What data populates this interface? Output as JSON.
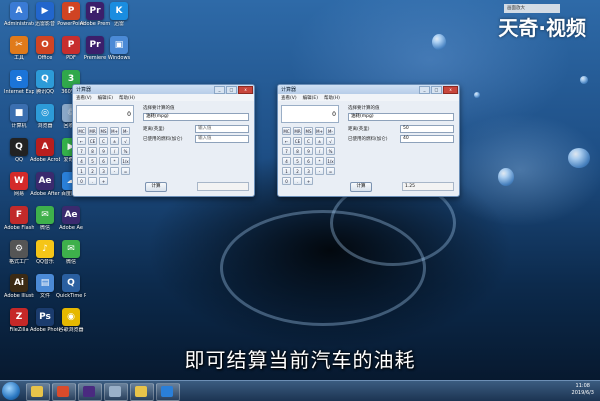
{
  "watermark": "天奇·视频",
  "notification": "画面放大",
  "subtitle": "即可结算当前汽车的油耗",
  "desktop_icons": [
    {
      "label": "Administrator",
      "color": "#3a7bd5",
      "glyph": "A"
    },
    {
      "label": "迅雷影音",
      "color": "#2266cc",
      "glyph": "▶"
    },
    {
      "label": "PowerPoint",
      "color": "#d04423",
      "glyph": "P"
    },
    {
      "label": "Adobe Premiere",
      "color": "#3b1f6b",
      "glyph": "Pr"
    },
    {
      "label": "迅雷",
      "color": "#1a8de0",
      "glyph": "K"
    },
    {
      "label": "工具",
      "color": "#e07a1a",
      "glyph": "✂"
    },
    {
      "label": "Office",
      "color": "#d04423",
      "glyph": "O"
    },
    {
      "label": "PDF",
      "color": "#c72e2e",
      "glyph": "P"
    },
    {
      "label": "Premiere",
      "color": "#3b1f6b",
      "glyph": "Pr"
    },
    {
      "label": "Windows",
      "color": "#4b8ad6",
      "glyph": "▣"
    },
    {
      "label": "Internet Explorer",
      "color": "#1b74d8",
      "glyph": "e"
    },
    {
      "label": "腾讯QQ",
      "color": "#2d9bd8",
      "glyph": "Q"
    },
    {
      "label": "360安全",
      "color": "#30a84b",
      "glyph": "3"
    },
    {
      "label": "计算机",
      "color": "#3b6fb0",
      "glyph": "■"
    },
    {
      "label": "浏览器",
      "color": "#2d9bd8",
      "glyph": "◎"
    },
    {
      "label": "回收站",
      "color": "#8aa8c8",
      "glyph": "♲"
    },
    {
      "label": "QQ",
      "color": "#222",
      "glyph": "Q"
    },
    {
      "label": "Adobe Acrobat",
      "color": "#b81e1e",
      "glyph": "A"
    },
    {
      "label": "爱奇艺",
      "color": "#34b04a",
      "glyph": "▶"
    },
    {
      "label": "网易",
      "color": "#d42a2a",
      "glyph": "W"
    },
    {
      "label": "Adobe After",
      "color": "#3a2a6e",
      "glyph": "Ae"
    },
    {
      "label": "百度网盘",
      "color": "#2a7fd8",
      "glyph": "☁"
    },
    {
      "label": "Adobe Flash",
      "color": "#c12a2a",
      "glyph": "F"
    },
    {
      "label": "微信",
      "color": "#3eb04b",
      "glyph": "✉"
    },
    {
      "label": "Adobe Ae",
      "color": "#3a2a6e",
      "glyph": "Ae"
    },
    {
      "label": "格式工厂",
      "color": "#555",
      "glyph": "⚙"
    },
    {
      "label": "QQ音乐",
      "color": "#f5c518",
      "glyph": "♪"
    },
    {
      "label": "微信",
      "color": "#3eb04b",
      "glyph": "✉"
    },
    {
      "label": "Adobe Illustrator",
      "color": "#3b2a14",
      "glyph": "Ai"
    },
    {
      "label": "文件",
      "color": "#4b8ad6",
      "glyph": "▤"
    },
    {
      "label": "QuickTime Player",
      "color": "#2a5fa0",
      "glyph": "Q"
    },
    {
      "label": "FileZilla",
      "color": "#c62828",
      "glyph": "Z"
    },
    {
      "label": "Adobe Photoshop",
      "color": "#1b3c6e",
      "glyph": "Ps"
    },
    {
      "label": "谷歌浏览器",
      "color": "#e6b800",
      "glyph": "◉"
    }
  ],
  "calc_left": {
    "title": "计算器",
    "menu": [
      "查看(V)",
      "编辑(E)",
      "帮助(H)"
    ],
    "display": "0",
    "keys": [
      "MC",
      "MR",
      "MS",
      "M+",
      "M-",
      "←",
      "CE",
      "C",
      "±",
      "√",
      "7",
      "8",
      "9",
      "/",
      "%",
      "4",
      "5",
      "6",
      "*",
      "1/x",
      "1",
      "2",
      "3",
      "-",
      "=",
      "0",
      ".",
      "+"
    ],
    "panel_title": "选择要计算的值",
    "select": "油耗(mpg)",
    "labels": [
      "距离(英里)",
      "已使用的燃料(加仑)"
    ],
    "placeholders": [
      "输入值",
      "输入值"
    ],
    "button": "计算",
    "result": ""
  },
  "calc_right": {
    "title": "计算器",
    "menu": [
      "查看(V)",
      "编辑(E)",
      "帮助(H)"
    ],
    "display": "0",
    "keys": [
      "MC",
      "MR",
      "MS",
      "M+",
      "M-",
      "←",
      "CE",
      "C",
      "±",
      "√",
      "7",
      "8",
      "9",
      "/",
      "%",
      "4",
      "5",
      "6",
      "*",
      "1/x",
      "1",
      "2",
      "3",
      "-",
      "=",
      "0",
      ".",
      "+"
    ],
    "panel_title": "选择要计算的值",
    "select": "油耗(mpg)",
    "labels": [
      "距离(英里)",
      "已使用的燃料(加仑)"
    ],
    "values": [
      "50",
      "40"
    ],
    "button": "计算",
    "result": "1.25"
  },
  "clock": {
    "time": "11:08",
    "date": "2019/6/3"
  },
  "taskbar_items": [
    {
      "name": "explorer",
      "color": "#e8c34a"
    },
    {
      "name": "media-player",
      "color": "#d94b2b"
    },
    {
      "name": "premiere",
      "color": "#4a2a80"
    },
    {
      "name": "calculator",
      "color": "#9ab0c8"
    },
    {
      "name": "folder",
      "color": "#e8c34a"
    },
    {
      "name": "browser",
      "color": "#2a7fd8"
    }
  ]
}
